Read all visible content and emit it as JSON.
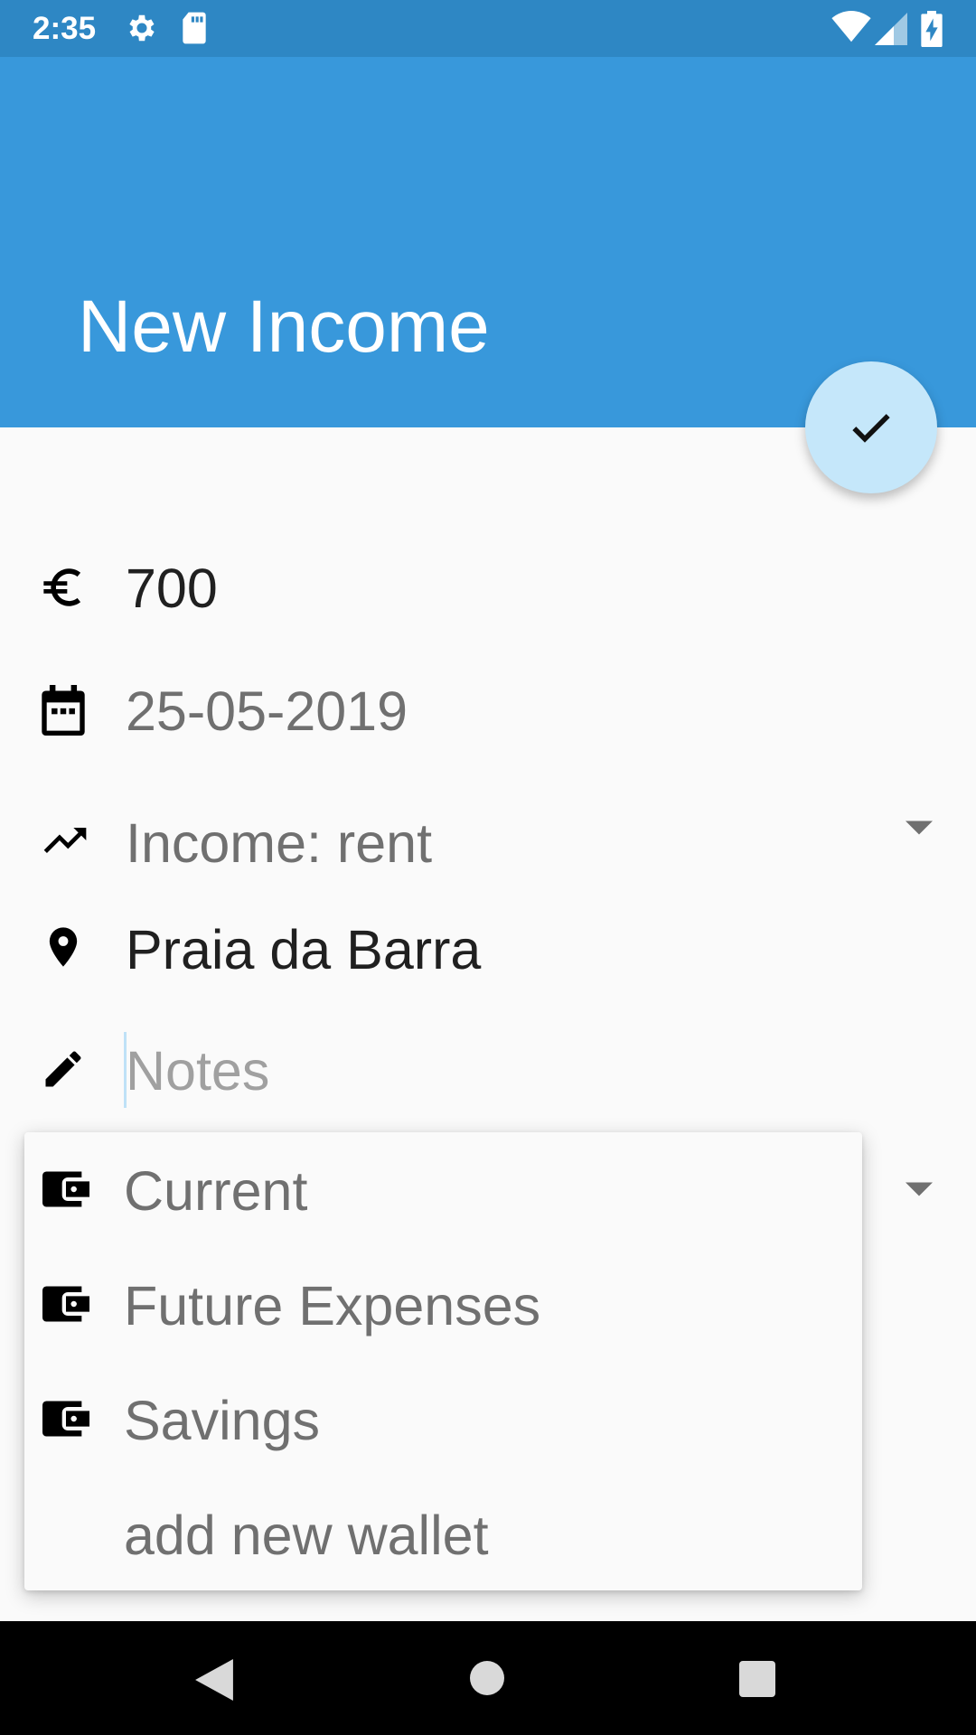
{
  "status_bar": {
    "time": "2:35",
    "icons": [
      "settings-icon",
      "sd-card-icon",
      "wifi-icon",
      "signal-icon",
      "battery-charging-icon"
    ]
  },
  "app_bar": {
    "title": "New Income",
    "color": "#3898db"
  },
  "fab": {
    "icon": "check-icon",
    "color": "#c5e7fa"
  },
  "form": {
    "amount": {
      "icon": "euro-icon",
      "value": "700"
    },
    "date": {
      "icon": "calendar-icon",
      "value": "25-05-2019"
    },
    "category": {
      "icon": "trending-up-icon",
      "value": "Income: rent",
      "dropdown_icon": "arrow-drop-down-icon"
    },
    "location": {
      "icon": "location-pin-icon",
      "value": "Praia da Barra"
    },
    "notes": {
      "icon": "pencil-icon",
      "placeholder": "Notes",
      "value": ""
    },
    "wallet": {
      "dropdown_icon": "arrow-drop-down-icon"
    }
  },
  "wallet_menu": {
    "items": [
      {
        "icon": "wallet-icon",
        "label": "Current"
      },
      {
        "icon": "wallet-icon",
        "label": "Future Expenses"
      },
      {
        "icon": "wallet-icon",
        "label": "Savings"
      },
      {
        "icon": "",
        "label": "add new wallet"
      }
    ]
  },
  "nav_bar": {
    "icons": [
      "back-icon",
      "home-icon",
      "recents-icon"
    ]
  }
}
